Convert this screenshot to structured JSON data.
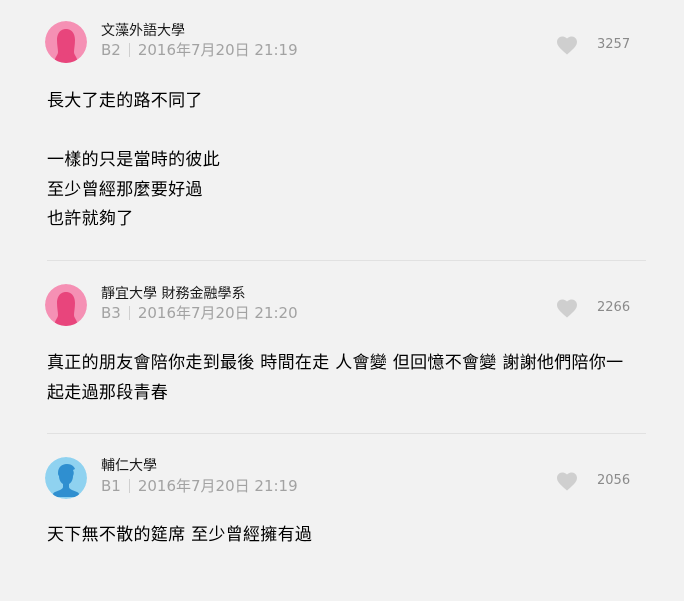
{
  "comments": [
    {
      "school": "文藻外語大學",
      "floor": "B2",
      "date": "2016年7月20日 21:19",
      "likes": "3257",
      "gender": "female",
      "content": "長大了走的路不同了\n\n一樣的只是當時的彼此\n至少曾經那麼要好過\n也許就夠了"
    },
    {
      "school": "靜宜大學 財務金融學系",
      "floor": "B3",
      "date": "2016年7月20日 21:20",
      "likes": "2266",
      "gender": "female",
      "content": "真正的朋友會陪你走到最後 時間在走 人會變 但回憶不會變 謝謝他們陪你一\n起走過那段青春"
    },
    {
      "school": "輔仁大學",
      "floor": "B1",
      "date": "2016年7月20日 21:19",
      "likes": "2056",
      "gender": "male",
      "content": "天下無不散的筵席 至少曾經擁有過"
    }
  ],
  "colors": {
    "female_avatar_bg": "#f590b4",
    "female_avatar_fg": "#e8457c",
    "male_avatar_bg": "#8fd2f0",
    "male_avatar_fg": "#2f8fd0",
    "heart": "#cfcfcf",
    "background": "#f2f2f2"
  }
}
